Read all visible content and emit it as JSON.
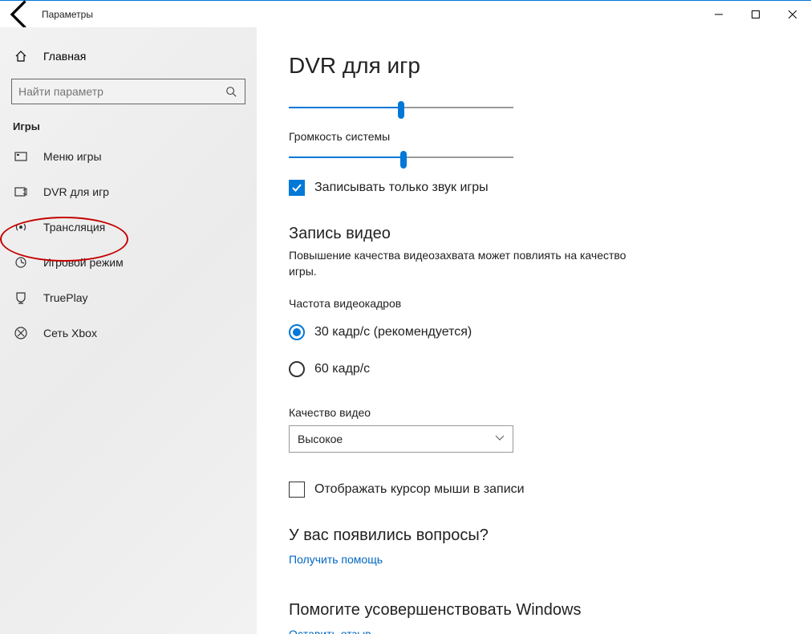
{
  "window": {
    "title": "Параметры"
  },
  "sidebar": {
    "home": "Главная",
    "search_placeholder": "Найти параметр",
    "category": "Игры",
    "items": [
      {
        "icon": "gamebar",
        "label": "Меню игры"
      },
      {
        "icon": "dvr",
        "label": "DVR для игр"
      },
      {
        "icon": "broadcast",
        "label": "Трансляция"
      },
      {
        "icon": "gamemode",
        "label": "Игровой режим"
      },
      {
        "icon": "trueplay",
        "label": "TruePlay"
      },
      {
        "icon": "xbox",
        "label": "Сеть Xbox"
      }
    ]
  },
  "main": {
    "heading": "DVR для игр",
    "slider1": {
      "label": "",
      "value": 50
    },
    "slider2": {
      "label": "Громкость системы",
      "value": 51
    },
    "record_game_only": "Записывать только звук игры",
    "section_video": {
      "title": "Запись видео",
      "desc": "Повышение качества видеозахвата может повлиять на качество игры.",
      "framerate_label": "Частота видеокадров",
      "option30": "30 кадр/с (рекомендуется)",
      "option60": "60 кадр/с",
      "quality_label": "Качество видео",
      "quality_value": "Высокое",
      "show_cursor": "Отображать курсор мыши в записи"
    },
    "questions": {
      "title": "У вас появились вопросы?",
      "link": "Получить помощь"
    },
    "feedback": {
      "title": "Помогите усовершенствовать Windows",
      "link": "Оставить отзыв"
    }
  }
}
